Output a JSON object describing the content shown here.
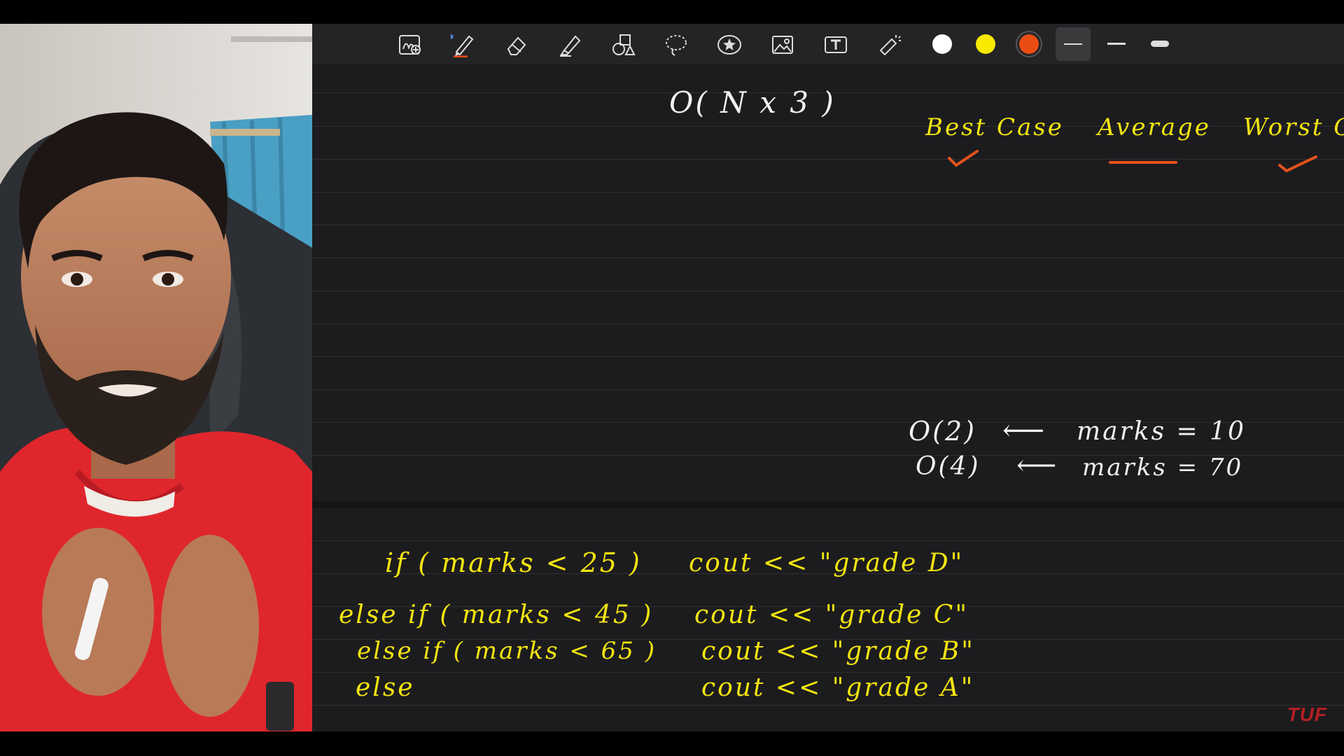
{
  "toolbar": {
    "tools": [
      {
        "name": "add-page-icon"
      },
      {
        "name": "pen-icon"
      },
      {
        "name": "eraser-icon"
      },
      {
        "name": "highlighter-icon"
      },
      {
        "name": "shapes-icon"
      },
      {
        "name": "lasso-icon"
      },
      {
        "name": "star-sticker-icon"
      },
      {
        "name": "image-icon"
      },
      {
        "name": "text-icon"
      },
      {
        "name": "laser-pointer-icon"
      }
    ],
    "colors": [
      "#ffffff",
      "#f7ea00",
      "#ea4d14"
    ],
    "selected_color": "#ea4d14"
  },
  "board": {
    "complexity": "O( N x 3 )",
    "cases": {
      "best": "Best Case",
      "average": "Average",
      "worst": "Worst Case"
    },
    "examples": [
      {
        "complexity": "O(2)",
        "arrow": "⟵",
        "label": "marks = 10"
      },
      {
        "complexity": "O(4)",
        "arrow": "⟵",
        "label": "marks = 70"
      }
    ],
    "code": [
      {
        "cond": "if ( marks < 25 )",
        "action": "cout << \"grade D\""
      },
      {
        "cond": "else if ( marks < 45 )",
        "action": "cout << \"grade C\""
      },
      {
        "cond": "else if ( marks < 65 )",
        "action": "cout << \"grade B\""
      },
      {
        "cond": "else",
        "action": "cout << \"grade A\""
      }
    ]
  },
  "logo": "TUF"
}
